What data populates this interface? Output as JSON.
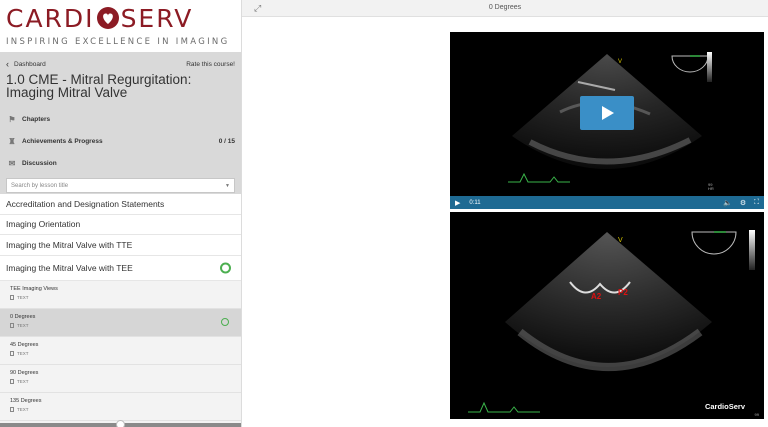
{
  "brand": {
    "logo_left": "CARDI",
    "logo_right": "SERV",
    "tagline": "INSPIRING EXCELLENCE IN IMAGING"
  },
  "header": {
    "dashboard_label": "Dashboard",
    "rate_label": "Rate this course!",
    "course_title": "1.0 CME - Mitral Regurgitation: Imaging Mitral Valve"
  },
  "nav": {
    "chapters": "Chapters",
    "achievements": "Achievements & Progress",
    "achievements_count": "0 / 15",
    "discussion": "Discussion"
  },
  "search": {
    "placeholder": "Search by lesson title"
  },
  "lessons": [
    {
      "label": "Accreditation and Designation Statements",
      "complete": false
    },
    {
      "label": "Imaging Orientation",
      "complete": false
    },
    {
      "label": "Imaging the Mitral Valve with TTE",
      "complete": false
    },
    {
      "label": "Imaging the Mitral Valve with TEE",
      "complete": true
    }
  ],
  "sublessons": [
    {
      "label": "TEE Imaging Views",
      "type": "TEXT",
      "active": false,
      "complete": false
    },
    {
      "label": "0 Degrees",
      "type": "TEXT",
      "active": true,
      "complete": true
    },
    {
      "label": "45 Degrees",
      "type": "TEXT",
      "active": false,
      "complete": false
    },
    {
      "label": "90 Degrees",
      "type": "TEXT",
      "active": false,
      "complete": false
    },
    {
      "label": "135 Degrees",
      "type": "TEXT",
      "active": false,
      "complete": false
    }
  ],
  "topbar": {
    "lesson_title": "0 Degrees"
  },
  "video": {
    "time": "0:11",
    "num1": "99",
    "num2": "HR"
  },
  "image2": {
    "label_a2": "A2",
    "label_p2": "P2",
    "brand": "CardioServ",
    "num": "99"
  },
  "colors": {
    "brand_red": "#8c1b24",
    "complete_green": "#4caf50",
    "video_bar": "#1e6a93",
    "play_button": "#3a8fc7",
    "annotation_red": "#d11111"
  }
}
